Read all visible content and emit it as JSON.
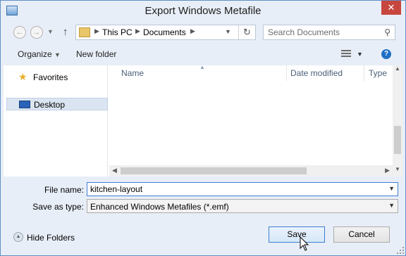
{
  "window": {
    "title": "Export Windows Metafile"
  },
  "address_bar": {
    "crumbs": [
      "This PC",
      "Documents"
    ]
  },
  "search": {
    "placeholder": "Search Documents"
  },
  "toolbar": {
    "organize_label": "Organize",
    "new_folder_label": "New folder"
  },
  "nav_pane": {
    "items": [
      {
        "label": "Favorites",
        "icon": "star-icon"
      },
      {
        "label": "Desktop",
        "icon": "desktop-icon",
        "selected": true
      }
    ]
  },
  "file_list": {
    "columns": [
      "Name",
      "Date modified",
      "Type"
    ]
  },
  "form": {
    "file_name_label": "File name:",
    "file_name_value": "kitchen-layout",
    "save_type_label": "Save as type:",
    "save_type_value": "Enhanced Windows Metafiles (*.emf)"
  },
  "footer": {
    "hide_folders_label": "Hide Folders",
    "save_label": "Save",
    "cancel_label": "Cancel"
  },
  "colors": {
    "window_bg": "#e8eef7",
    "window_border": "#5f8fc8",
    "close_button": "#c7463e",
    "focus_border": "#3c7fd1",
    "selection": "#dbe5f1"
  }
}
